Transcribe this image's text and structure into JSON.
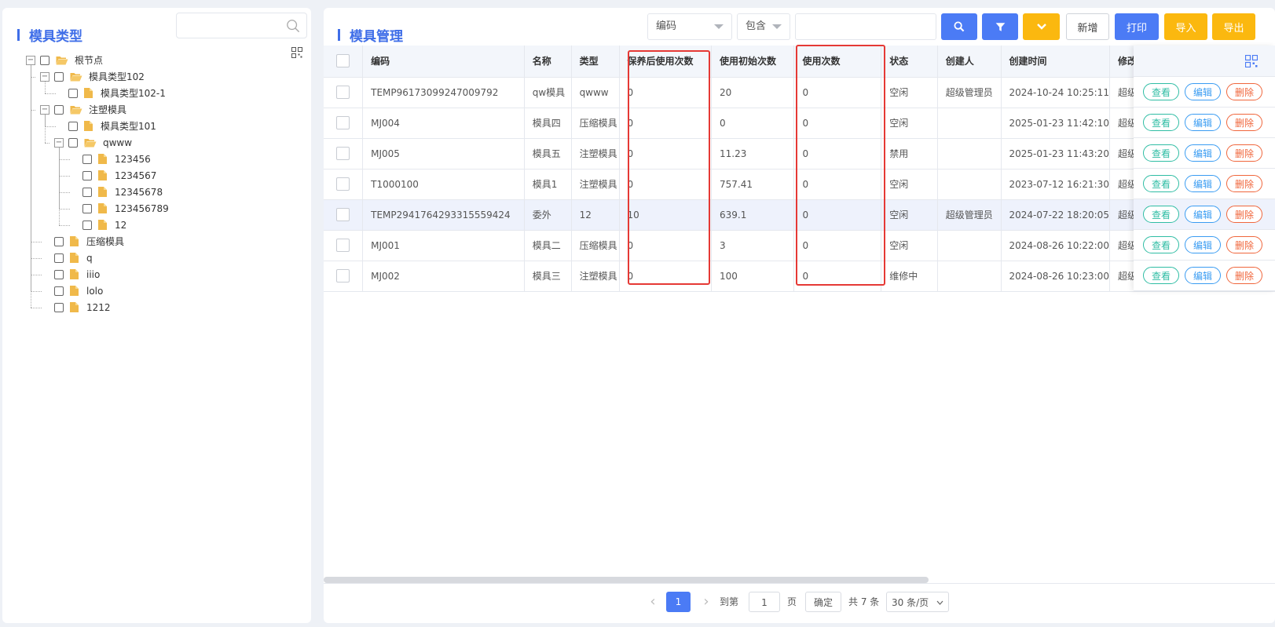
{
  "left": {
    "title": "模具类型",
    "search_placeholder": "",
    "tree": [
      {
        "label": "根节点",
        "level": 0,
        "type": "folder",
        "expand": "−"
      },
      {
        "label": "模具类型102",
        "level": 1,
        "type": "folder",
        "expand": "−"
      },
      {
        "label": "模具类型102-1",
        "level": 2,
        "type": "file",
        "expand": ""
      },
      {
        "label": "注塑模具",
        "level": 1,
        "type": "folder",
        "expand": "−"
      },
      {
        "label": "模具类型101",
        "level": 2,
        "type": "file",
        "expand": ""
      },
      {
        "label": "qwww",
        "level": 2,
        "type": "folder",
        "expand": "−"
      },
      {
        "label": "123456",
        "level": 3,
        "type": "file",
        "expand": ""
      },
      {
        "label": "1234567",
        "level": 3,
        "type": "file",
        "expand": ""
      },
      {
        "label": "12345678",
        "level": 3,
        "type": "file",
        "expand": ""
      },
      {
        "label": "123456789",
        "level": 3,
        "type": "file",
        "expand": ""
      },
      {
        "label": "12",
        "level": 3,
        "type": "file",
        "expand": ""
      },
      {
        "label": "压缩模具",
        "level": 1,
        "type": "file",
        "expand": ""
      },
      {
        "label": "q",
        "level": 1,
        "type": "file",
        "expand": ""
      },
      {
        "label": "iiio",
        "level": 1,
        "type": "file",
        "expand": ""
      },
      {
        "label": "lolo",
        "level": 1,
        "type": "file",
        "expand": ""
      },
      {
        "label": "1212",
        "level": 1,
        "type": "file",
        "expand": ""
      }
    ]
  },
  "main": {
    "title": "模具管理",
    "filter_field": "编码",
    "filter_op": "包含",
    "filter_value": "",
    "buttons": {
      "add": "新增",
      "print": "打印",
      "import": "导入",
      "export": "导出"
    },
    "columns": [
      "编码",
      "名称",
      "类型",
      "保养后使用次数",
      "使用初始次数",
      "使用次数",
      "状态",
      "创建人",
      "创建时间",
      "修改"
    ],
    "rows": [
      [
        "TEMP96173099247009792",
        "qw模具",
        "qwww",
        "0",
        "20",
        "0",
        "空闲",
        "超级管理员",
        "2024-10-24 10:25:11",
        "超级"
      ],
      [
        "MJ004",
        "模具四",
        "压缩模具",
        "0",
        "0",
        "0",
        "空闲",
        "",
        "2025-01-23 11:42:10",
        "超级"
      ],
      [
        "MJ005",
        "模具五",
        "注塑模具",
        "0",
        "11.23",
        "0",
        "禁用",
        "",
        "2025-01-23 11:43:20",
        "超级"
      ],
      [
        "T1000100",
        "模具1",
        "注塑模具",
        "0",
        "757.41",
        "0",
        "空闲",
        "",
        "2023-07-12 16:21:30",
        "超级"
      ],
      [
        "TEMP2941764293315559424",
        "委外",
        "12",
        "10",
        "639.1",
        "0",
        "空闲",
        "超级管理员",
        "2024-07-22 18:20:05",
        "超级"
      ],
      [
        "MJ001",
        "模具二",
        "压缩模具",
        "0",
        "3",
        "0",
        "空闲",
        "",
        "2024-08-26 10:22:00",
        "超级"
      ],
      [
        "MJ002",
        "模具三",
        "注塑模具",
        "0",
        "100",
        "0",
        "维修中",
        "",
        "2024-08-26 10:23:00",
        "超级"
      ]
    ],
    "highlighted_row": 4,
    "ops": {
      "view": "查看",
      "edit": "编辑",
      "delete": "删除"
    },
    "pager": {
      "prev": "‹",
      "current": "1",
      "next": "›",
      "goto_label": "到第",
      "goto_value": "1",
      "page_unit": "页",
      "confirm": "确定",
      "total": "共 7 条",
      "page_size": "30 条/页"
    }
  },
  "colors": {
    "primary": "#4b7bf5",
    "warning": "#fbb80f",
    "title": "#3f6ee8",
    "highlight_box": "#e53935",
    "view": "#2fbda4",
    "edit": "#3a9cf2",
    "delete": "#f0663c"
  }
}
